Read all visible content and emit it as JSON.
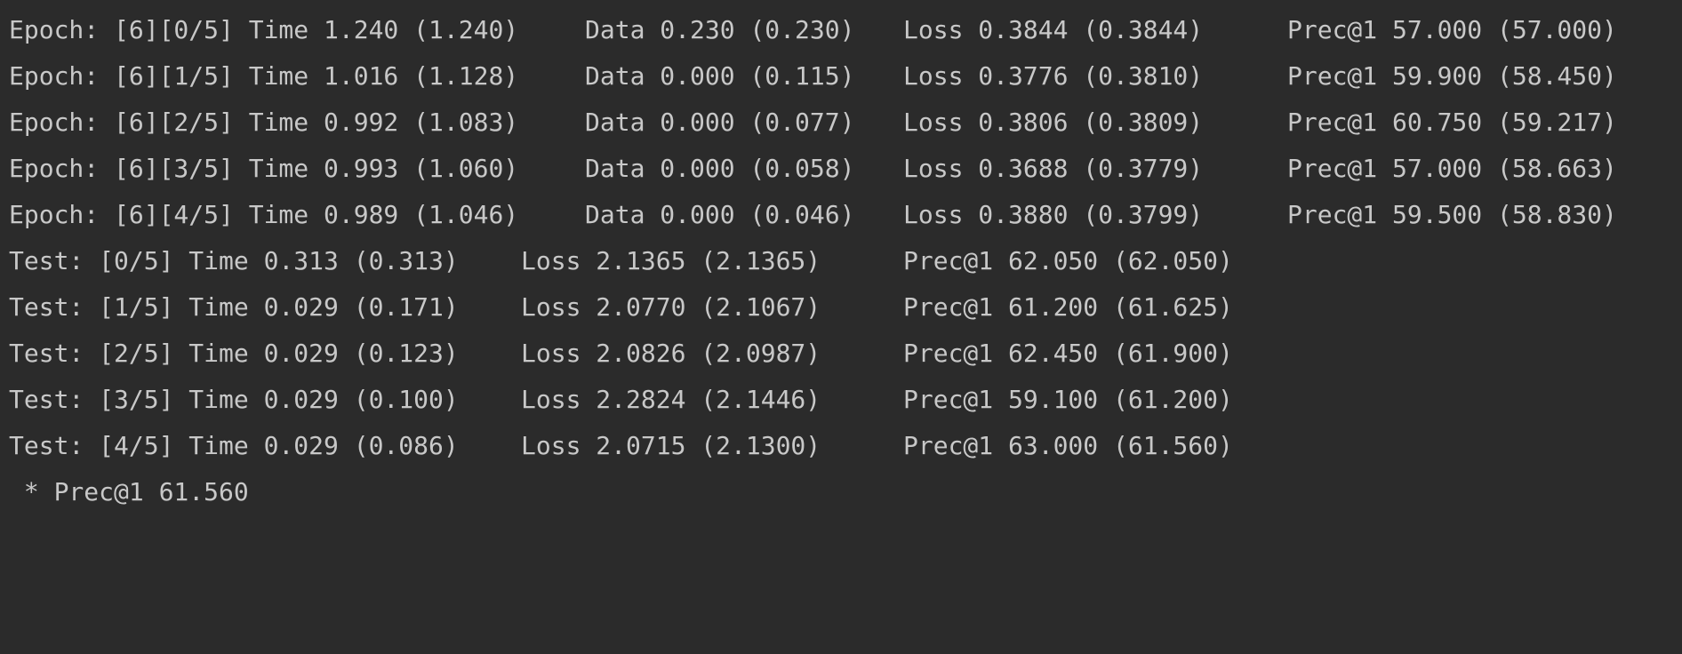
{
  "console": {
    "train_lines": [
      {
        "epoch": "Epoch: [6][0/5] Time 1.240 (1.240)",
        "data": "Data 0.230 (0.230)",
        "loss": "Loss 0.3844 (0.3844)",
        "prec": "Prec@1 57.000 (57.000)"
      },
      {
        "epoch": "Epoch: [6][1/5] Time 1.016 (1.128)",
        "data": "Data 0.000 (0.115)",
        "loss": "Loss 0.3776 (0.3810)",
        "prec": "Prec@1 59.900 (58.450)"
      },
      {
        "epoch": "Epoch: [6][2/5] Time 0.992 (1.083)",
        "data": "Data 0.000 (0.077)",
        "loss": "Loss 0.3806 (0.3809)",
        "prec": "Prec@1 60.750 (59.217)"
      },
      {
        "epoch": "Epoch: [6][3/5] Time 0.993 (1.060)",
        "data": "Data 0.000 (0.058)",
        "loss": "Loss 0.3688 (0.3779)",
        "prec": "Prec@1 57.000 (58.663)"
      },
      {
        "epoch": "Epoch: [6][4/5] Time 0.989 (1.046)",
        "data": "Data 0.000 (0.046)",
        "loss": "Loss 0.3880 (0.3799)",
        "prec": "Prec@1 59.500 (58.830)"
      }
    ],
    "test_lines": [
      {
        "test": "Test: [0/5] Time 0.313 (0.313)",
        "loss": "Loss 2.1365 (2.1365)",
        "prec": "Prec@1 62.050 (62.050)"
      },
      {
        "test": "Test: [1/5] Time 0.029 (0.171)",
        "loss": "Loss 2.0770 (2.1067)",
        "prec": "Prec@1 61.200 (61.625)"
      },
      {
        "test": "Test: [2/5] Time 0.029 (0.123)",
        "loss": "Loss 2.0826 (2.0987)",
        "prec": "Prec@1 62.450 (61.900)"
      },
      {
        "test": "Test: [3/5] Time 0.029 (0.100)",
        "loss": "Loss 2.2824 (2.1446)",
        "prec": "Prec@1 59.100 (61.200)"
      },
      {
        "test": "Test: [4/5] Time 0.029 (0.086)",
        "loss": "Loss 2.0715 (2.1300)",
        "prec": "Prec@1 63.000 (61.560)"
      }
    ],
    "summary": " * Prec@1 61.560"
  }
}
